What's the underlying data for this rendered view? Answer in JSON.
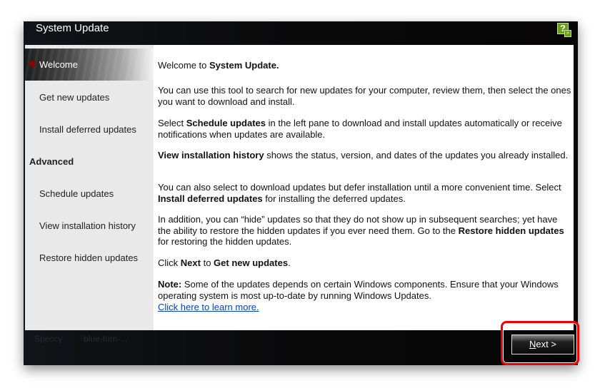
{
  "window": {
    "title": "System Update",
    "help_icon": "help-icon",
    "minimize_icon": "chevron-down-icon"
  },
  "sidebar": {
    "welcome": "Welcome",
    "items": [
      "Get new updates",
      "Install deferred updates"
    ],
    "advanced_header": "Advanced",
    "advanced_items": [
      "Schedule updates",
      "View installation history",
      "Restore hidden updates"
    ]
  },
  "main": {
    "p1": {
      "a": "Welcome to ",
      "b": "System Update."
    },
    "p2": "You can use this tool to search for new updates for your computer, review them, then select the ones you want to download and install.",
    "p3": {
      "a": "Select ",
      "b": "Schedule updates",
      "c": " in the left pane to download and install updates automatically or receive notifications when updates are available."
    },
    "p4": {
      "b": "View installation history",
      "c": " shows the status, version, and dates of the updates you already installed."
    },
    "p5": {
      "a": "You can also select to download updates but defer installation until a more convenient time. Select ",
      "b": "Install deferred updates",
      "c": " for installing the deferred updates."
    },
    "p6": {
      "a": "In addition, you can “hide” updates so that they do not show up in subsequent searches; yet have the ability to restore the hidden updates if you ever need them. Go to the ",
      "b": "Restore hidden updates",
      "c": " for restoring the hidden updates."
    },
    "p7": {
      "a": "Click ",
      "b": "Next",
      "c": " to ",
      "d": "Get new updates",
      "e": "."
    },
    "p8": {
      "b": "Note:",
      "c": " Some of the updates depends on certain Windows components. Ensure that your Windows operating system is most up-to-date by running Windows Updates."
    },
    "link": "Click here to learn more."
  },
  "background": {
    "items": [
      "Speccy",
      "blue-turn-..."
    ]
  },
  "footer": {
    "next_n": "N",
    "next_rest": "ext >",
    "highlight_color": "#e00000"
  }
}
